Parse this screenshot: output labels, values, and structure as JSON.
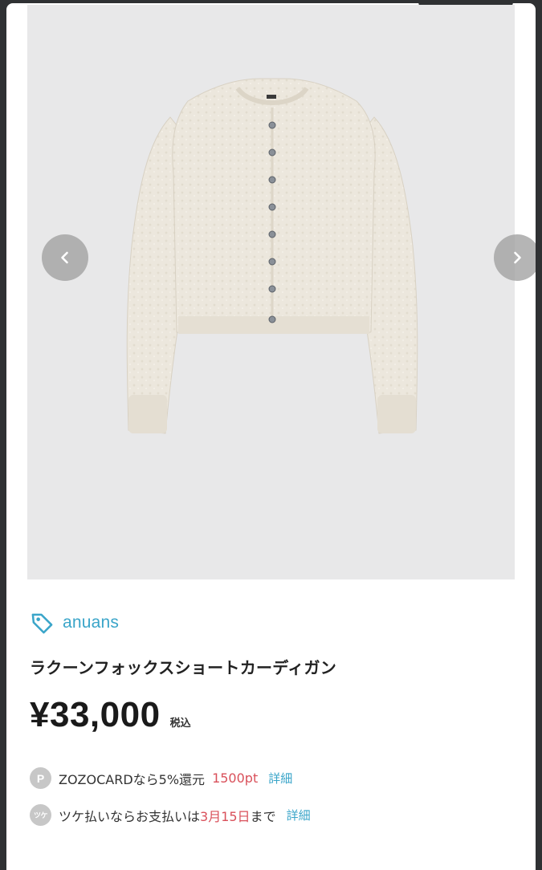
{
  "product": {
    "brand": "anuans",
    "title": "ラクーンフォックスショートカーディガン",
    "price": "¥33,000",
    "tax_label": "税込"
  },
  "carousel": {
    "prev_icon": "chevron-left-icon",
    "next_icon": "chevron-right-icon"
  },
  "zozocard": {
    "badge": "P",
    "text": "ZOZOCARDなら5%還元",
    "points": "1500pt",
    "detail_link": "詳細"
  },
  "tsuke": {
    "badge": "ツケ",
    "text_before": "ツケ払いならお支払いは",
    "date": "3月15日",
    "text_after": "まで",
    "detail_link": "詳細"
  },
  "colors": {
    "accent": "#3aa5c9",
    "highlight_red": "#d9505a",
    "image_bg": "#e8e8e9"
  }
}
